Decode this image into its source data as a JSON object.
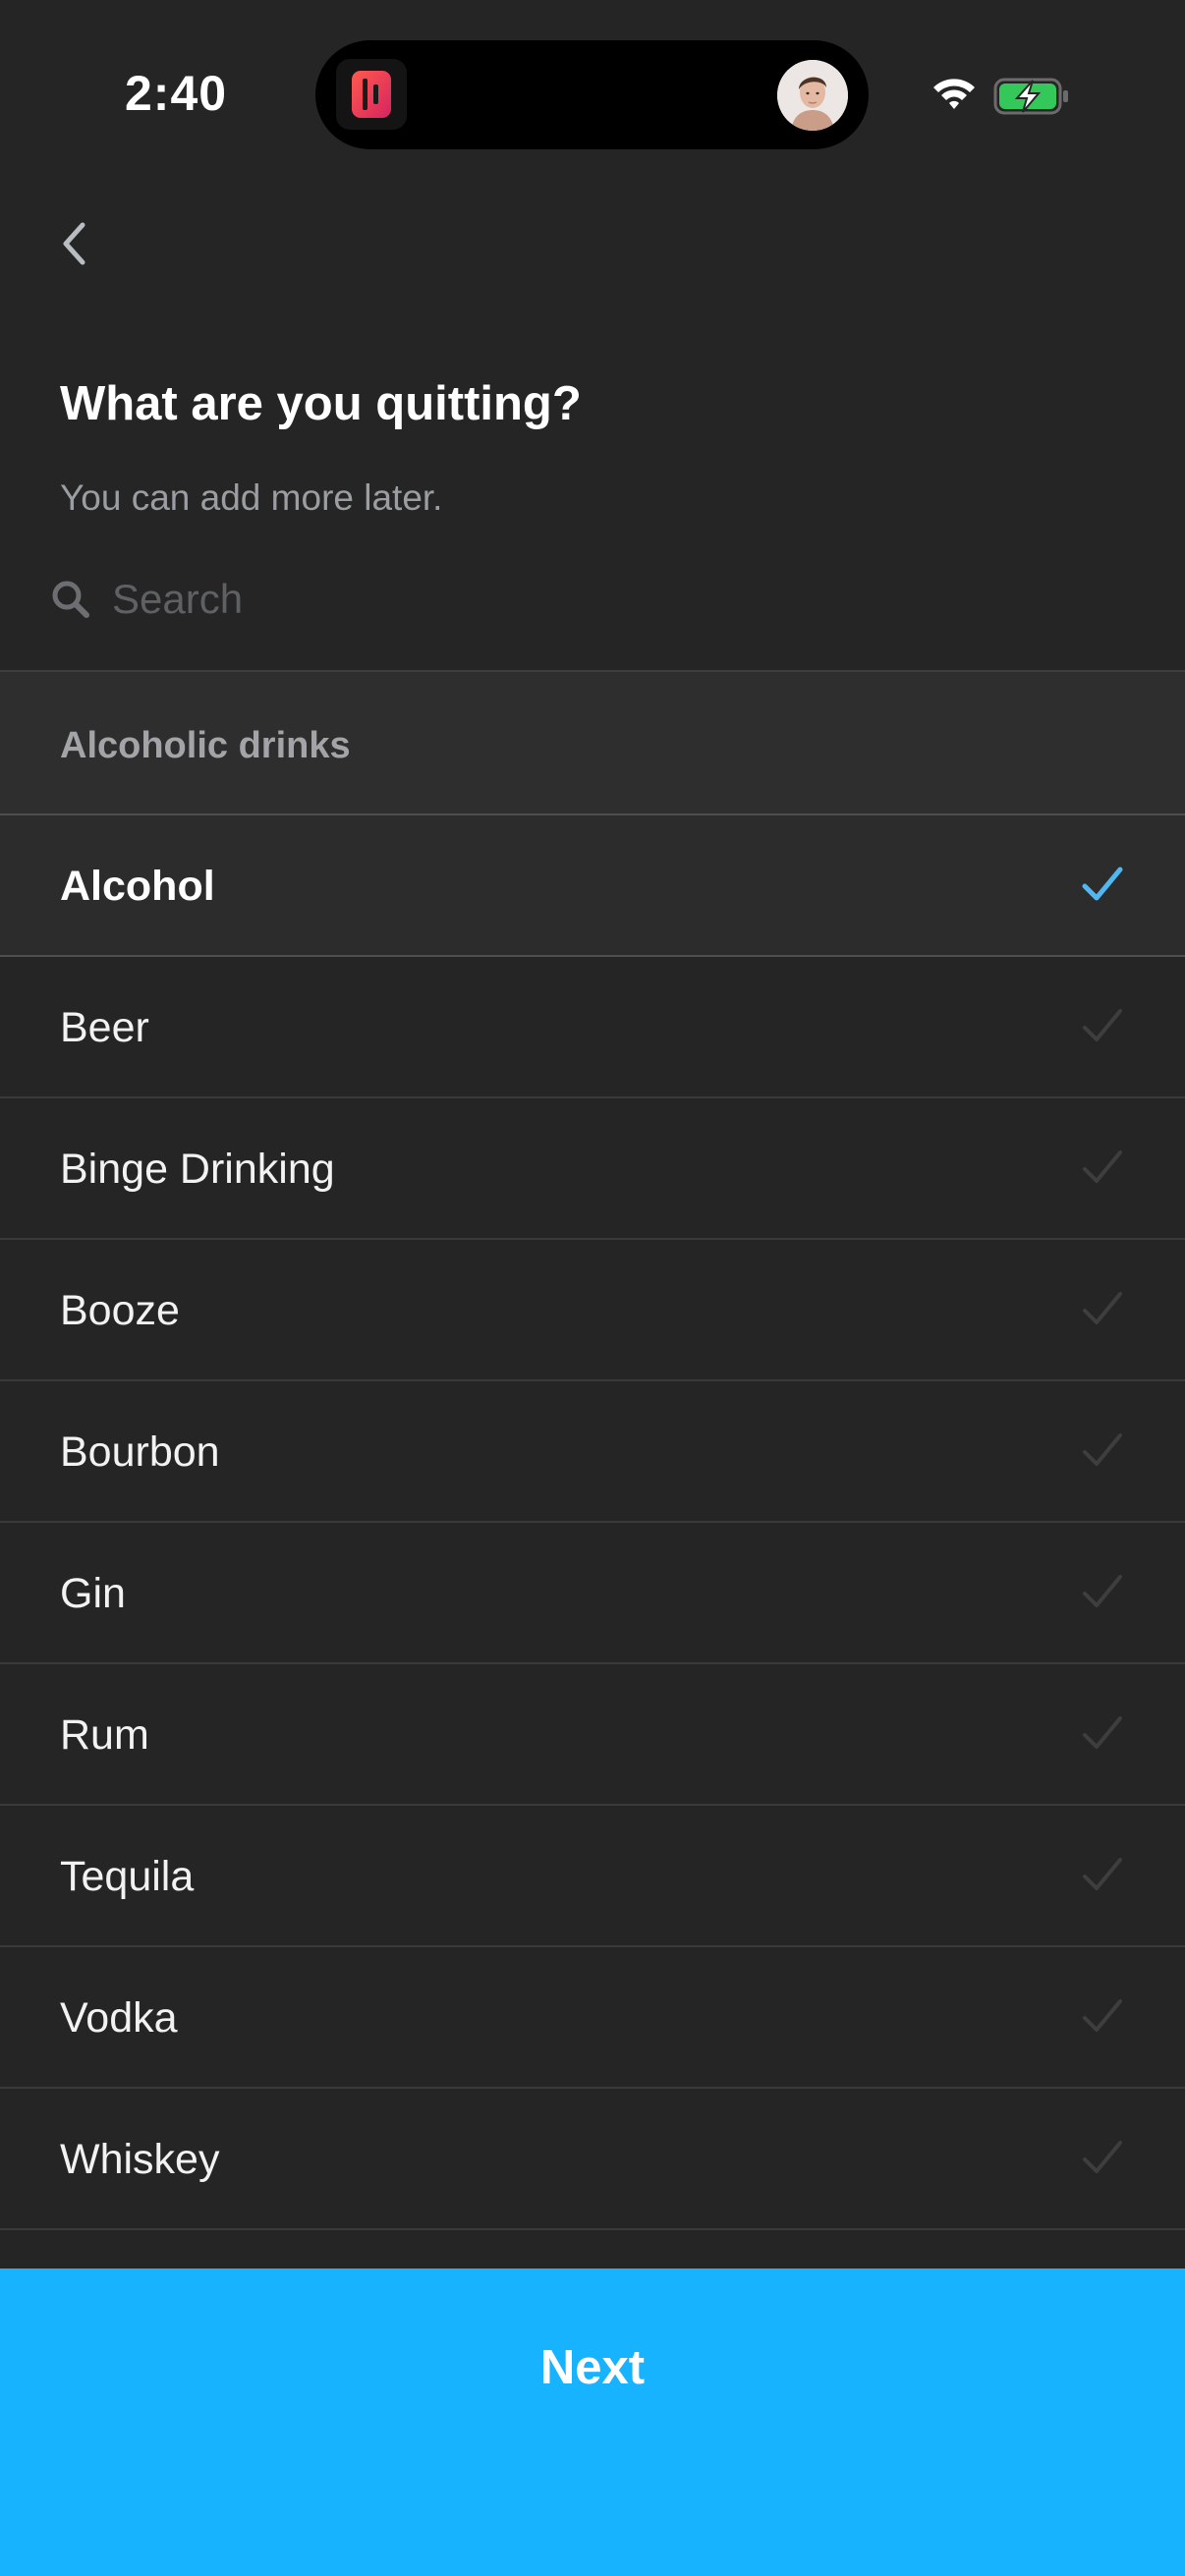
{
  "status_bar": {
    "time": "2:40",
    "wifi_icon": "wifi-icon",
    "battery_icon": "battery-charging-icon"
  },
  "header": {
    "back_icon": "chevron-left-icon",
    "title": "What are you quitting?",
    "subtitle": "You can add more later."
  },
  "search": {
    "icon": "search-icon",
    "placeholder": "Search",
    "value": ""
  },
  "list": {
    "section_title": "Alcoholic drinks",
    "items": [
      {
        "label": "Alcohol",
        "selected": true
      },
      {
        "label": "Beer",
        "selected": false
      },
      {
        "label": "Binge Drinking",
        "selected": false
      },
      {
        "label": "Booze",
        "selected": false
      },
      {
        "label": "Bourbon",
        "selected": false
      },
      {
        "label": "Gin",
        "selected": false
      },
      {
        "label": "Rum",
        "selected": false
      },
      {
        "label": "Tequila",
        "selected": false
      },
      {
        "label": "Vodka",
        "selected": false
      },
      {
        "label": "Whiskey",
        "selected": false
      }
    ]
  },
  "footer": {
    "next_label": "Next"
  },
  "colors": {
    "background": "#252525",
    "accent": "#18b3ff",
    "check_selected": "#4fb8f2",
    "check_unselected": "#3e3e3e",
    "subtitle": "#9a9da1"
  }
}
